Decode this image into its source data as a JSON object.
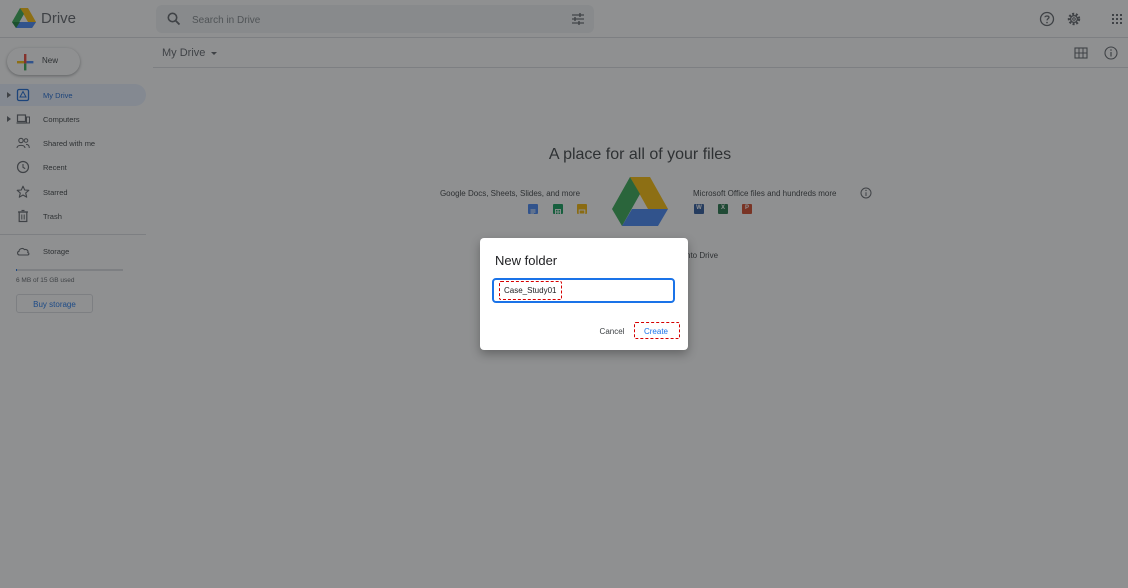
{
  "header": {
    "app_name": "Drive",
    "search_placeholder": "Search in Drive"
  },
  "sidebar": {
    "new_label": "New",
    "items": [
      {
        "label": "My Drive",
        "icon": "my-drive-icon",
        "active": true
      },
      {
        "label": "Computers",
        "icon": "computer-icon"
      },
      {
        "label": "Shared with me",
        "icon": "people-icon"
      },
      {
        "label": "Recent",
        "icon": "clock-icon"
      },
      {
        "label": "Starred",
        "icon": "star-icon"
      },
      {
        "label": "Trash",
        "icon": "trash-icon"
      }
    ],
    "storage_label": "Storage",
    "storage_used": "6 MB of 15 GB used",
    "storage_fraction": 0.0004,
    "buy_storage": "Buy storage"
  },
  "main": {
    "breadcrumb": "My Drive",
    "empty_title": "A place for all of your files",
    "left_caption": "Google Docs, Sheets, Slides, and more",
    "right_caption": "Microsoft Office files and hundreds more",
    "drop_hint": "nto Drive",
    "office_icons": [
      "W",
      "X",
      "P"
    ]
  },
  "dialog": {
    "title": "New folder",
    "input_value": "Case_Study01",
    "cancel": "Cancel",
    "create": "Create"
  },
  "colors": {
    "accent": "#1a73e8",
    "highlight": "#d50000",
    "docs": "#4285f4",
    "sheets": "#0f9d58",
    "slides": "#f4b400",
    "word": "#2b579a",
    "excel": "#217346",
    "powerpoint": "#d24726"
  }
}
